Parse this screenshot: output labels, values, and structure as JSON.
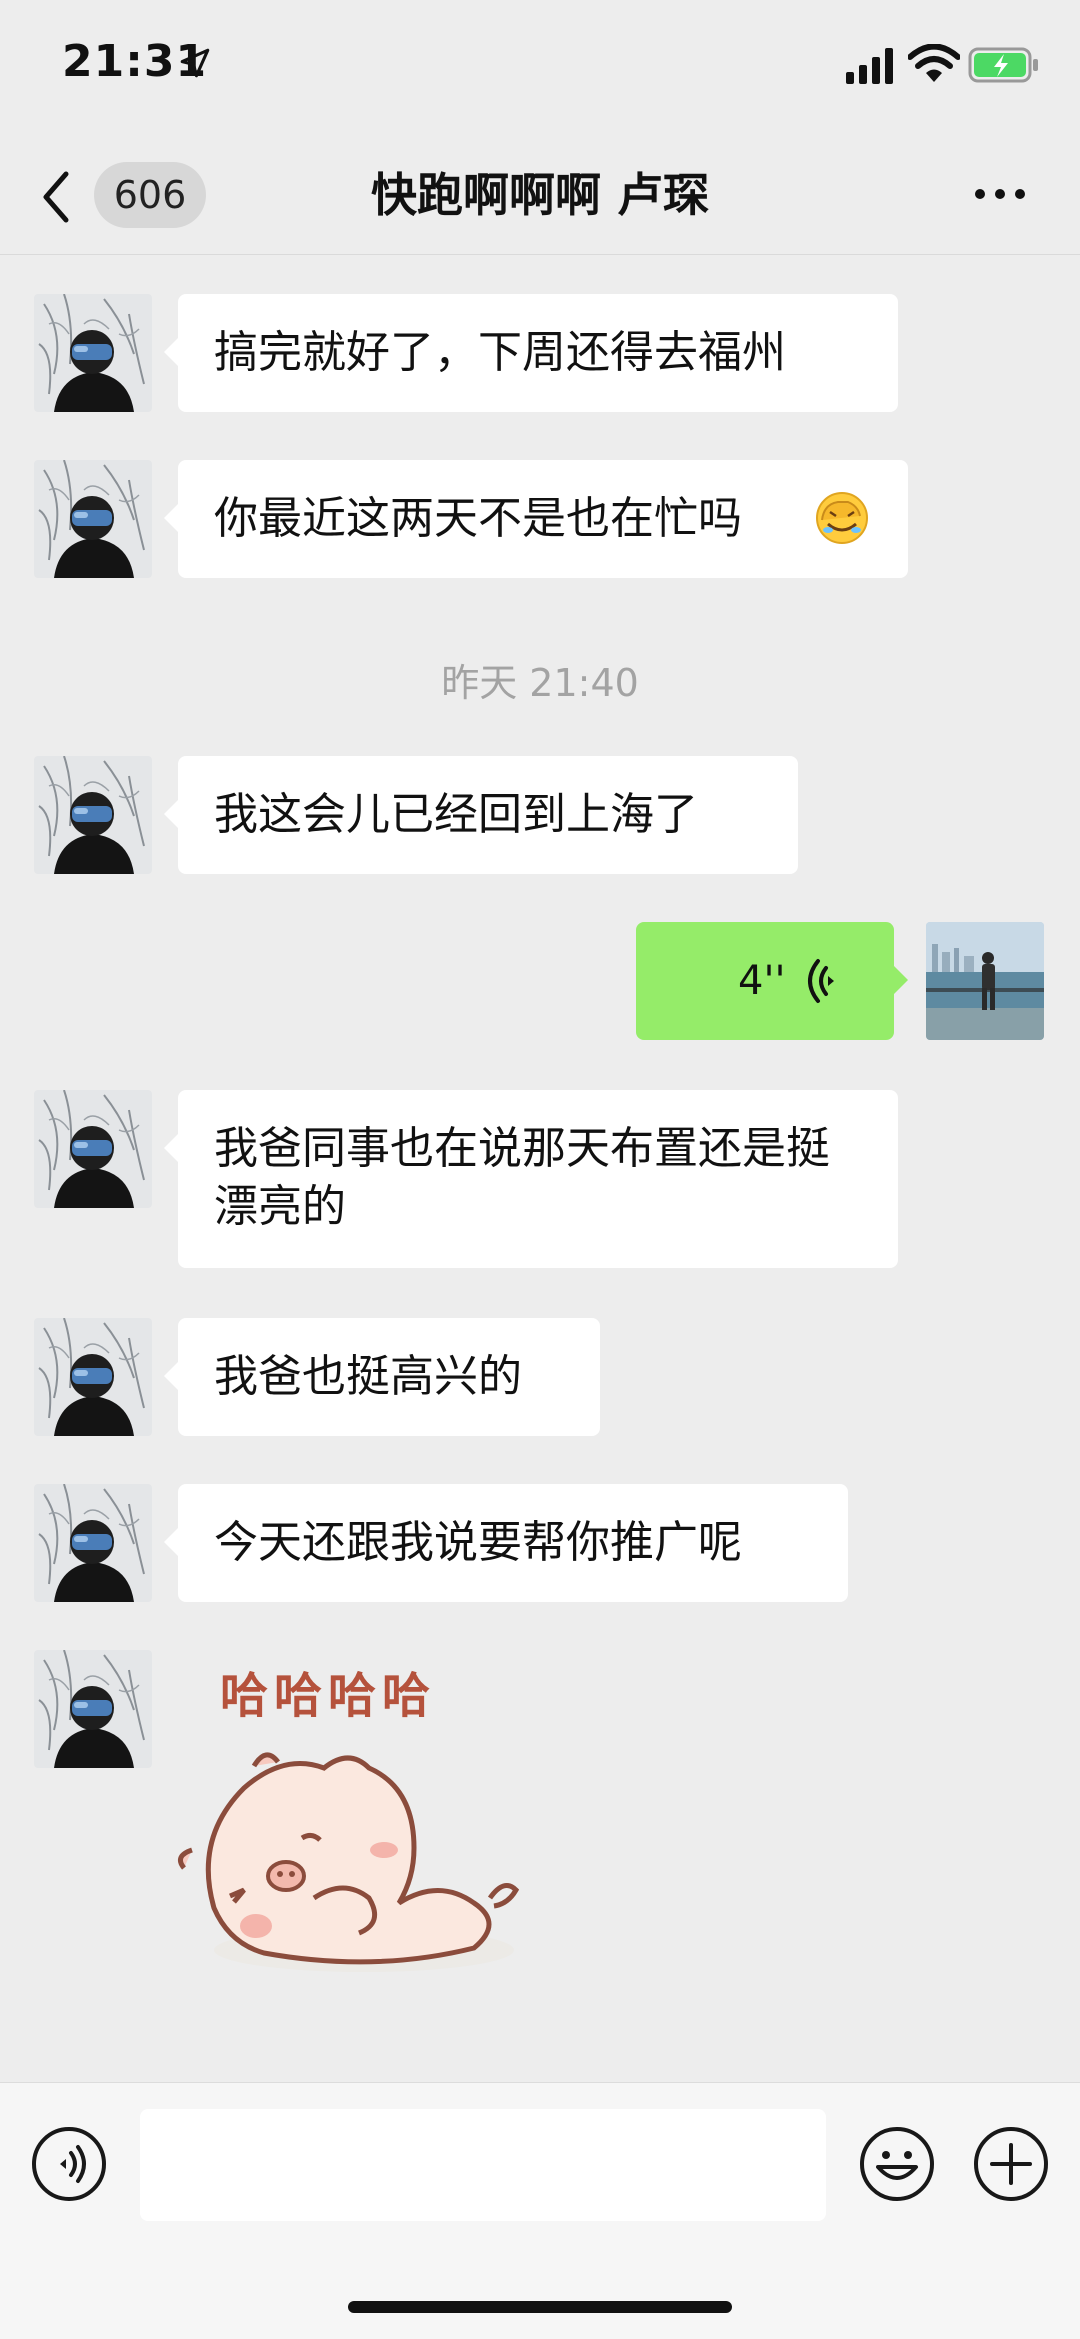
{
  "status_bar": {
    "time": "21:31"
  },
  "nav": {
    "unread_count": "606",
    "title": "快跑啊啊啊 卢琛"
  },
  "messages": [
    {
      "text": "搞完就好了，下周还得去福州"
    },
    {
      "text": "你最近这两天不是也在忙吗"
    },
    {
      "text": "我这会儿已经回到上海了"
    },
    {
      "text": "我爸同事也在说那天布置还是挺漂亮的"
    },
    {
      "text": "我爸也挺高兴的"
    },
    {
      "text": "今天还跟我说要帮你推广呢"
    }
  ],
  "timestamp": "昨天 21:40",
  "voice_message": {
    "duration": "4''"
  },
  "sticker": {
    "caption": "哈哈哈哈"
  },
  "colors": {
    "sent_bubble": "#95ec69",
    "received_bubble": "#ffffff",
    "background": "#ededed"
  },
  "icons": [
    "location-arrow-icon",
    "signal-icon",
    "wifi-icon",
    "battery-icon",
    "back-chevron-icon",
    "more-icon",
    "voice-wave-icon",
    "voice-toggle-icon",
    "emoji-icon",
    "plus-icon",
    "facepalm-emoji-icon",
    "pig-sticker"
  ]
}
